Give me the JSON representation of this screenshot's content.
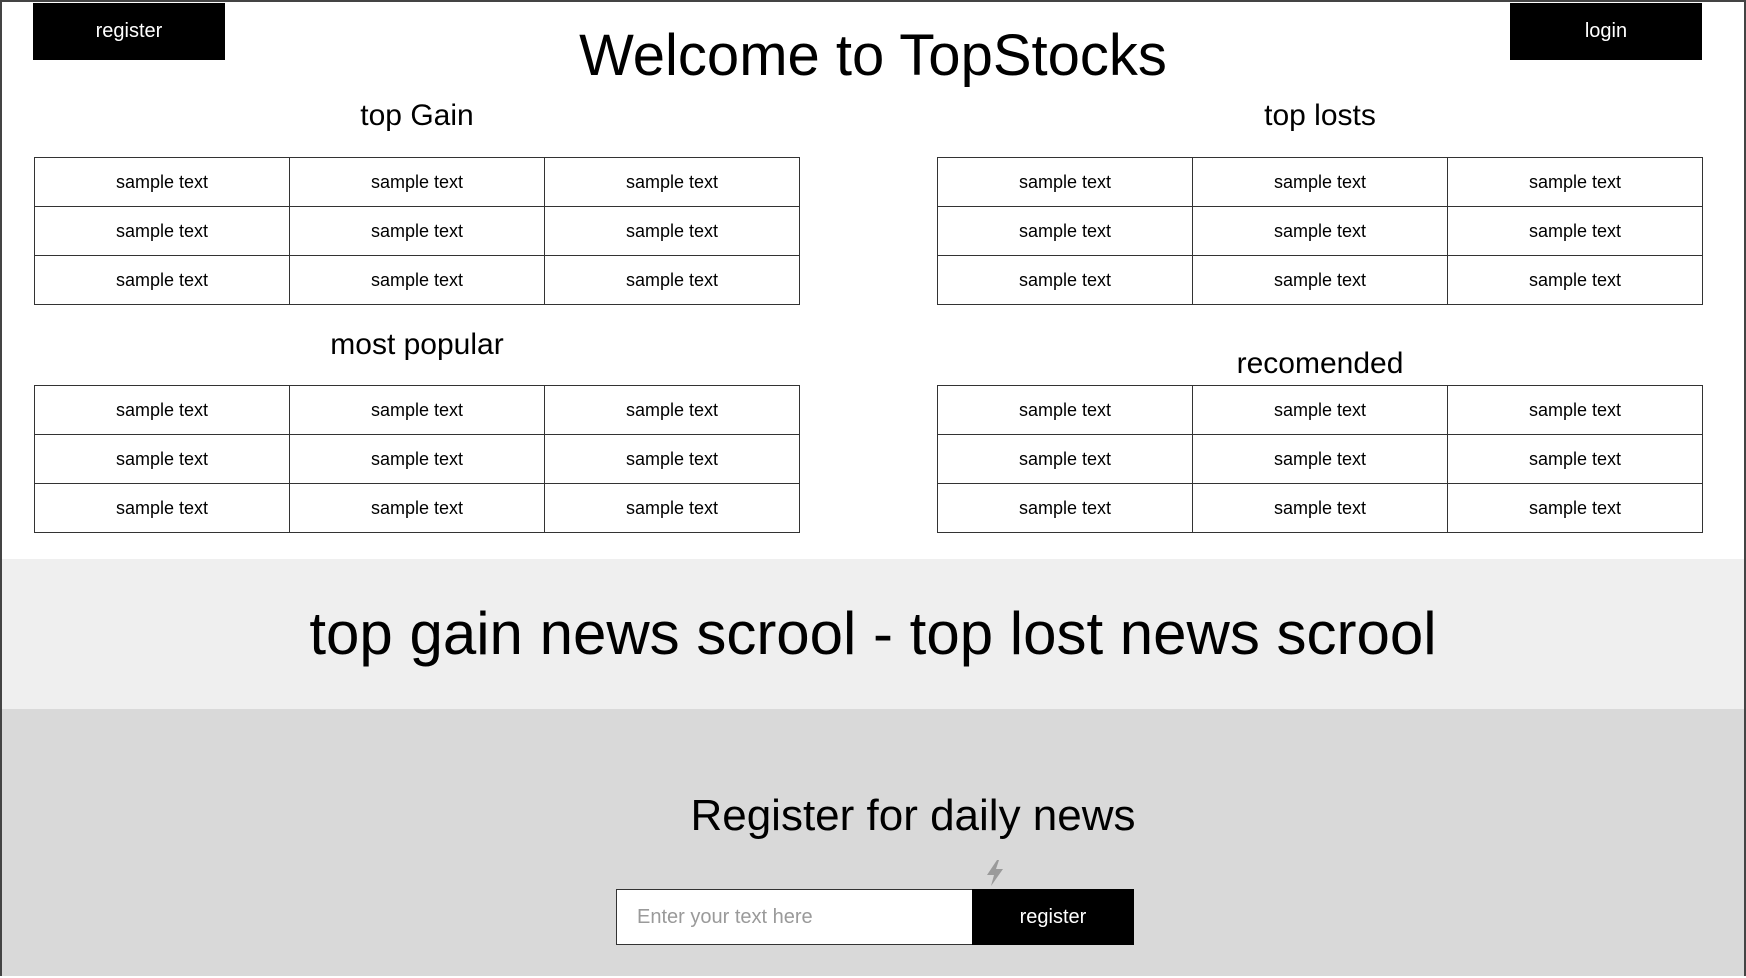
{
  "header": {
    "register_label": "register",
    "login_label": "login",
    "title": "Welcome to TopStocks"
  },
  "sections": {
    "top_gain": {
      "title": "top Gain",
      "rows": [
        [
          "sample text",
          "sample text",
          "sample text"
        ],
        [
          "sample text",
          "sample text",
          "sample text"
        ],
        [
          "sample text",
          "sample text",
          "sample text"
        ]
      ]
    },
    "top_lost": {
      "title": "top losts",
      "rows": [
        [
          "sample text",
          "sample text",
          "sample text"
        ],
        [
          "sample text",
          "sample text",
          "sample text"
        ],
        [
          "sample text",
          "sample text",
          "sample text"
        ]
      ]
    },
    "most_popular": {
      "title": "most popular",
      "rows": [
        [
          "sample text",
          "sample text",
          "sample text"
        ],
        [
          "sample text",
          "sample text",
          "sample text"
        ],
        [
          "sample text",
          "sample text",
          "sample text"
        ]
      ]
    },
    "recommended": {
      "title": "recomended",
      "rows": [
        [
          "sample text",
          "sample text",
          "sample text"
        ],
        [
          "sample text",
          "sample text",
          "sample text"
        ],
        [
          "sample text",
          "sample text",
          "sample text"
        ]
      ]
    }
  },
  "news": {
    "text": "top gain news scrool - top lost news scrool"
  },
  "newsletter": {
    "title": "Register for daily news",
    "input_placeholder": "Enter your text here",
    "button_label": "register",
    "icon": "lightning-bolt-icon"
  },
  "colors": {
    "button_bg": "#000000",
    "news_band_bg": "#efefef",
    "register_band_bg": "#d9d9d9"
  }
}
